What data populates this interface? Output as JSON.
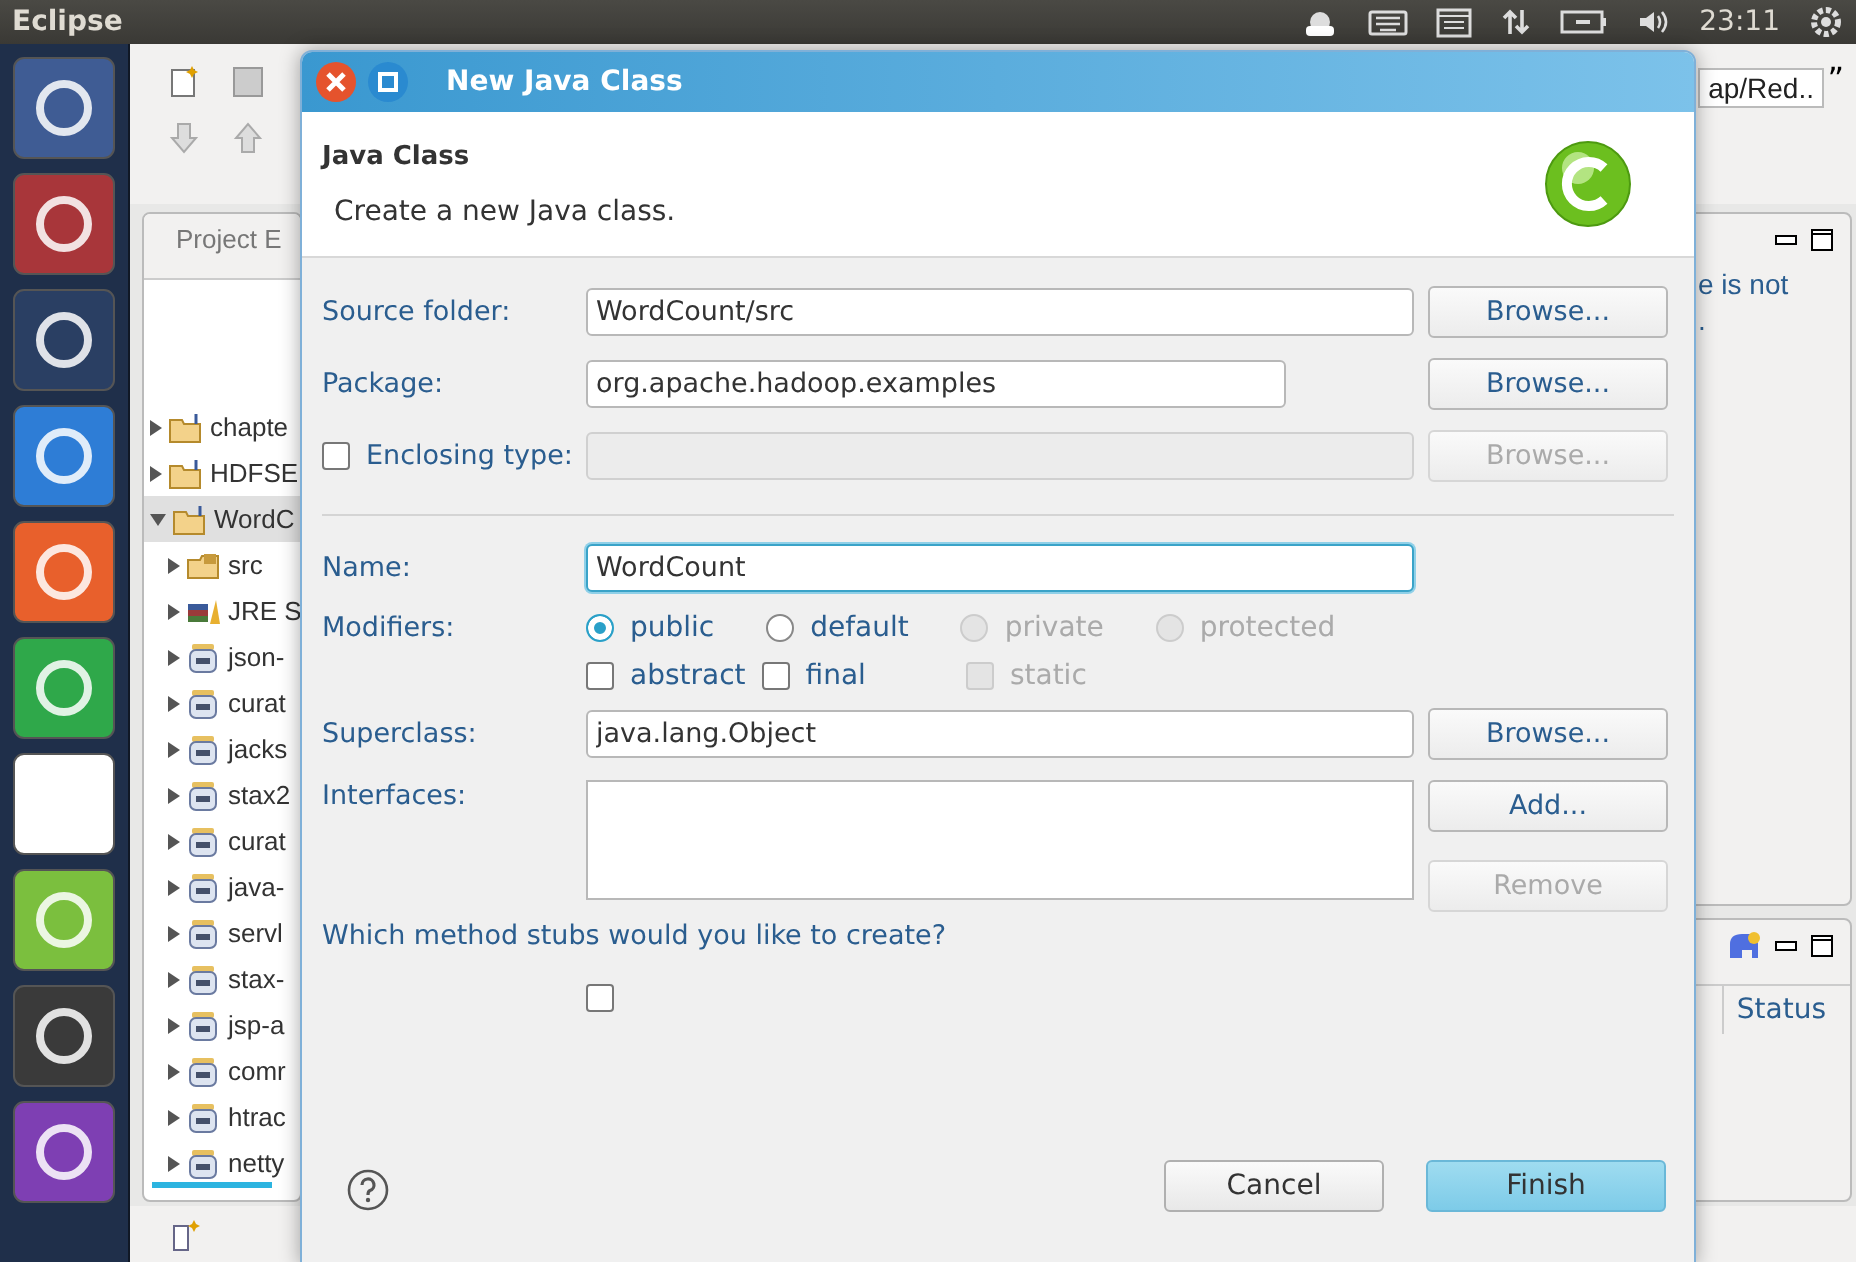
{
  "top_bar": {
    "title": "Eclipse",
    "clock": "23:11"
  },
  "workbench": {
    "toolbar_text": "ap/Red..",
    "overflow": "”",
    "project_explorer": {
      "title": "Project E",
      "tree": [
        {
          "label": "chapte",
          "kind": "project",
          "expanded": false,
          "selected": false
        },
        {
          "label": "HDFSE",
          "kind": "project",
          "expanded": false,
          "selected": false
        },
        {
          "label": "WordC",
          "kind": "project",
          "expanded": true,
          "selected": true,
          "children": [
            {
              "label": "src",
              "kind": "source",
              "expanded": false,
              "selected": false
            },
            {
              "label": "JRE S",
              "kind": "library",
              "expanded": false,
              "selected": false
            },
            {
              "label": "json-",
              "kind": "jar",
              "expanded": false,
              "selected": false
            },
            {
              "label": "curat",
              "kind": "jar",
              "expanded": false,
              "selected": false
            },
            {
              "label": "jacks",
              "kind": "jar",
              "expanded": false,
              "selected": false
            },
            {
              "label": "stax2",
              "kind": "jar",
              "expanded": false,
              "selected": false
            },
            {
              "label": "curat",
              "kind": "jar",
              "expanded": false,
              "selected": false
            },
            {
              "label": "java-",
              "kind": "jar",
              "expanded": false,
              "selected": false
            },
            {
              "label": "servl",
              "kind": "jar",
              "expanded": false,
              "selected": false
            },
            {
              "label": "stax-",
              "kind": "jar",
              "expanded": false,
              "selected": false
            },
            {
              "label": "jsp-a",
              "kind": "jar",
              "expanded": false,
              "selected": false
            },
            {
              "label": "comr",
              "kind": "jar",
              "expanded": false,
              "selected": false
            },
            {
              "label": "htrac",
              "kind": "jar",
              "expanded": false,
              "selected": false
            },
            {
              "label": "netty",
              "kind": "jar",
              "expanded": false,
              "selected": false
            }
          ]
        }
      ]
    },
    "outline_lines": [
      "e is not",
      "."
    ],
    "tasks": {
      "columns": [
        "Status"
      ]
    }
  },
  "dialog": {
    "title": "New Java Class",
    "heading": "Java Class",
    "description": "Create a new Java class.",
    "fields": [
      {
        "kind": "text",
        "label": "Source folder:",
        "value": "WordCount/src",
        "button": "Browse...",
        "disabled": false
      },
      {
        "kind": "text",
        "label": "Package:",
        "value": "org.apache.hadoop.examples",
        "button": "Browse...",
        "disabled": false
      },
      {
        "kind": "checkbox",
        "label": "Enclosing type:",
        "checked": false,
        "button": "Browse...",
        "disabled": true
      }
    ],
    "name": {
      "label": "Name:",
      "value": "WordCount"
    },
    "modifiers": {
      "label": "Modifiers:",
      "access": [
        {
          "label": "public",
          "selected": true,
          "disabled": false
        },
        {
          "label": "default",
          "selected": false,
          "disabled": false
        },
        {
          "label": "private",
          "selected": false,
          "disabled": true
        },
        {
          "label": "protected",
          "selected": false,
          "disabled": true
        }
      ],
      "flags": [
        {
          "label": "abstract",
          "checked": false,
          "disabled": false
        },
        {
          "label": "final",
          "checked": false,
          "disabled": false
        },
        {
          "label": "static",
          "checked": false,
          "disabled": true
        }
      ]
    },
    "superclass": {
      "label": "Superclass:",
      "value": "java.lang.Object",
      "button": "Browse..."
    },
    "interfaces": {
      "label": "Interfaces:",
      "buttons": [
        {
          "label": "Add...",
          "disabled": false
        },
        {
          "label": "Remove",
          "disabled": true
        }
      ]
    },
    "stubs_question": "Which method stubs would you like to create?",
    "main_stub": {
      "checked": false
    },
    "buttons": [
      {
        "label": "Cancel",
        "kind": "secondary"
      },
      {
        "label": "Finish",
        "kind": "default"
      }
    ]
  }
}
